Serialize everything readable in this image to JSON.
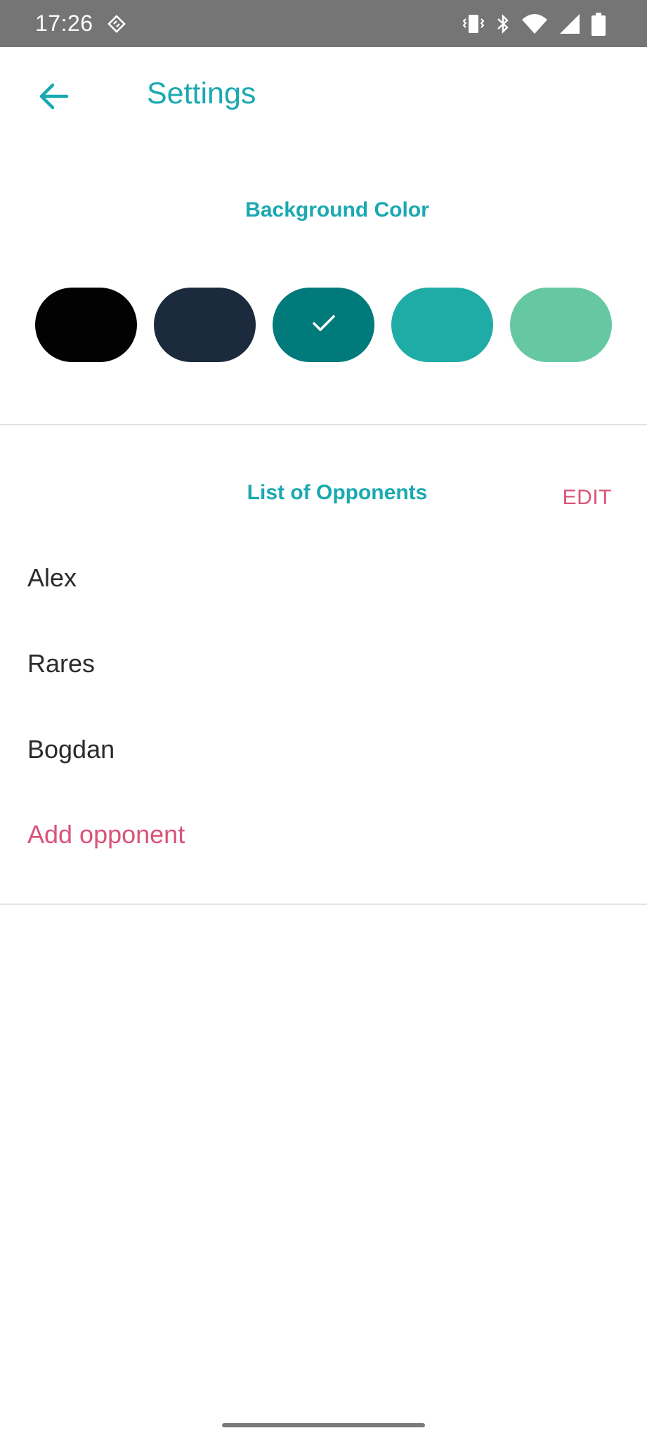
{
  "status_bar": {
    "time": "17:26",
    "left_icon": "android-debug-diamond-icon",
    "right_icons": [
      "vibrate-icon",
      "bluetooth-icon",
      "wifi-icon",
      "cellular-signal-icon",
      "battery-icon"
    ]
  },
  "app_bar": {
    "back_icon": "arrow-left-icon",
    "title": "Settings"
  },
  "background_color": {
    "title": "Background Color",
    "swatches": [
      {
        "color": "#020202",
        "selected": false
      },
      {
        "color": "#1c2a3e",
        "selected": false
      },
      {
        "color": "#007a7a",
        "selected": true
      },
      {
        "color": "#20aca6",
        "selected": false
      },
      {
        "color": "#65c8a3",
        "selected": false
      }
    ],
    "selected_icon": "check-icon"
  },
  "opponents": {
    "title": "List of Opponents",
    "edit_label": "EDIT",
    "items": [
      "Alex",
      "Rares",
      "Bogdan"
    ],
    "add_label": "Add opponent"
  },
  "colors": {
    "accent_teal": "#1aa9b0",
    "accent_pink": "#d9537a",
    "status_bar_bg": "#757575"
  }
}
